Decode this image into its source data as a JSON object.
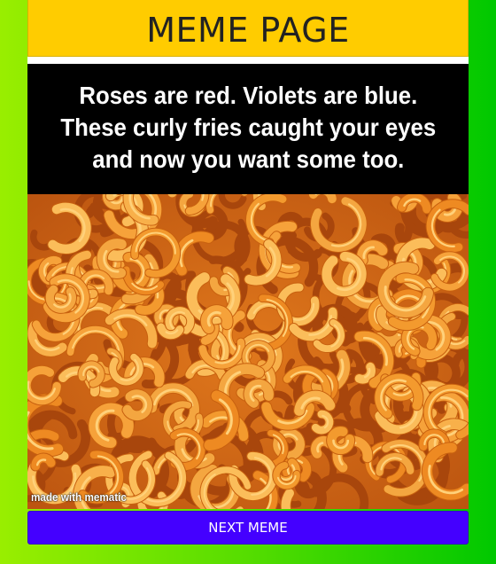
{
  "header": {
    "title": "MEME PAGE"
  },
  "meme": {
    "caption_lines": [
      "Roses are red. Violets are blue.",
      "These curly fries caught your eyes",
      "and now you want some too."
    ],
    "image_subject": "curly fries",
    "watermark": "made with mematic"
  },
  "actions": {
    "next_label": "NEXT MEME"
  },
  "colors": {
    "header_bg": "#ffcc00",
    "button_bg": "#4400ff",
    "page_gradient_start": "#99ee00",
    "page_gradient_end": "#00c800"
  }
}
